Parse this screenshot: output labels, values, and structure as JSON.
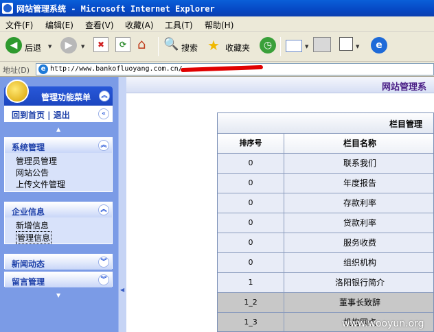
{
  "window": {
    "title": "网站管理系统 - Microsoft Internet Explorer"
  },
  "menubar": [
    "文件(F)",
    "编辑(E)",
    "查看(V)",
    "收藏(A)",
    "工具(T)",
    "帮助(H)"
  ],
  "toolbar": {
    "back_label": "后退",
    "search_label": "搜索",
    "favorites_label": "收藏夹"
  },
  "address": {
    "label": "地址(D)",
    "url": "http://www.bankofluoyang.com.cn/"
  },
  "sidebar": {
    "title": "管理功能菜单",
    "home_links": "回到首页 | 退出",
    "sections": [
      {
        "title": "系统管理",
        "items": [
          "管理员管理",
          "网站公告",
          "上传文件管理"
        ]
      },
      {
        "title": "企业信息",
        "items": [
          "新增信息",
          "管理信息"
        ]
      },
      {
        "title": "新闻动态",
        "items": []
      },
      {
        "title": "留言管理",
        "items": []
      }
    ]
  },
  "main": {
    "page_title": "网站管理系",
    "table_title": "栏目管理",
    "headers": [
      "排序号",
      "栏目名称"
    ],
    "rows": [
      {
        "order": "0",
        "name": "联系我们"
      },
      {
        "order": "0",
        "name": "年度报告"
      },
      {
        "order": "0",
        "name": "存款利率"
      },
      {
        "order": "0",
        "name": "贷款利率"
      },
      {
        "order": "0",
        "name": "服务收费"
      },
      {
        "order": "0",
        "name": "组织机构"
      },
      {
        "order": "1",
        "name": "洛阳银行简介"
      },
      {
        "order": "1_2",
        "name": "董事长致辞"
      },
      {
        "order": "1_3",
        "name": "机构网点"
      }
    ]
  },
  "watermark": "www.wooyun.org"
}
